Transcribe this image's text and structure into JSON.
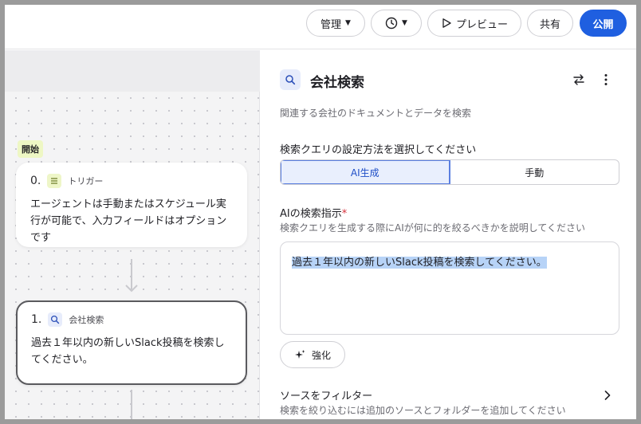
{
  "topbar": {
    "manage_label": "管理",
    "history_icon": "clock-icon",
    "preview_label": "プレビュー",
    "share_label": "共有",
    "publish_label": "公開",
    "accent": "#1f5fe0"
  },
  "canvas": {
    "start_label": "開始",
    "nodes": [
      {
        "number": "0.",
        "type": "トリガー",
        "icon": "list-icon",
        "body": "エージェントは手動またはスケジュール実行が可能で、入力フィールドはオプションです"
      },
      {
        "number": "1.",
        "type": "会社検索",
        "icon": "search-icon",
        "body": "過去１年以内の新しいSlack投稿を検索してください。"
      }
    ]
  },
  "panel": {
    "title": "会社検索",
    "icon": "search-icon",
    "description": "関連する会社のドキュメントとデータを検索",
    "mode_question": "検索クエリの設定方法を選択してください",
    "modes": [
      "AI生成",
      "手動"
    ],
    "selected_mode": "AI生成",
    "instruction_label": "AIの検索指示",
    "required_mark": "*",
    "instruction_help": "検索クエリを生成する際にAIが何に的を絞るべきかを説明してください",
    "instruction_value": "過去１年以内の新しいSlack投稿を検索してください。",
    "enhance_label": "強化",
    "filter_title": "ソースをフィルター",
    "filter_help": "検索を絞り込むには追加のソースとフォルダーを追加してください"
  }
}
